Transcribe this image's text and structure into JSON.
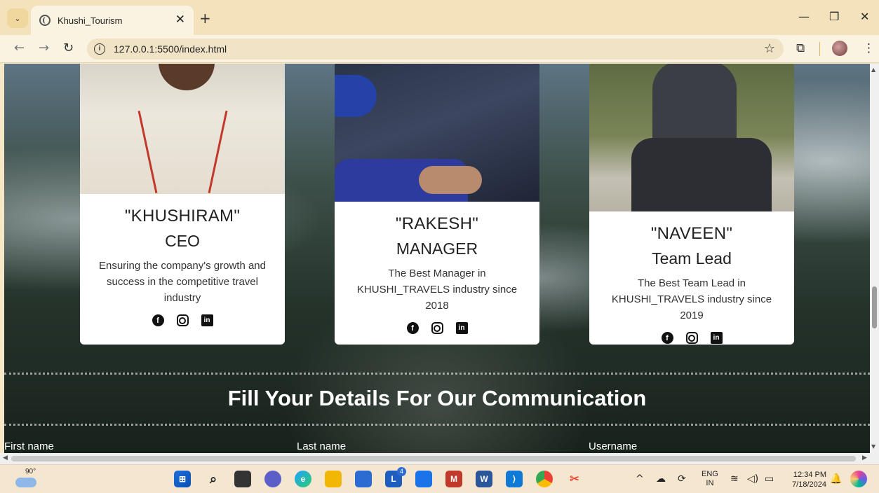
{
  "browser": {
    "tab_title": "Khushi_Tourism",
    "url": "127.0.0.1:5500/index.html"
  },
  "team": [
    {
      "name": "\"KHUSHIRAM\"",
      "role": "CEO",
      "description": "Ensuring the company's growth and success in the competitive travel industry"
    },
    {
      "name": "\"RAKESH\"",
      "role": "MANAGER",
      "description": "The Best Manager in KHUSHI_TRAVELS industry since 2018"
    },
    {
      "name": "\"NAVEEN\"",
      "role": "Team Lead",
      "description": "The Best Team Lead in KHUSHI_TRAVELS industry since 2019"
    }
  ],
  "contact": {
    "title": "Fill Your Details For Our Communication",
    "fields": [
      "First name",
      "Last name",
      "Username"
    ]
  },
  "taskbar": {
    "weather_temp": "90°",
    "lang_line1": "ENG",
    "lang_line2": "IN",
    "time": "12:34 PM",
    "date": "7/18/2024",
    "badge_count": "4"
  }
}
